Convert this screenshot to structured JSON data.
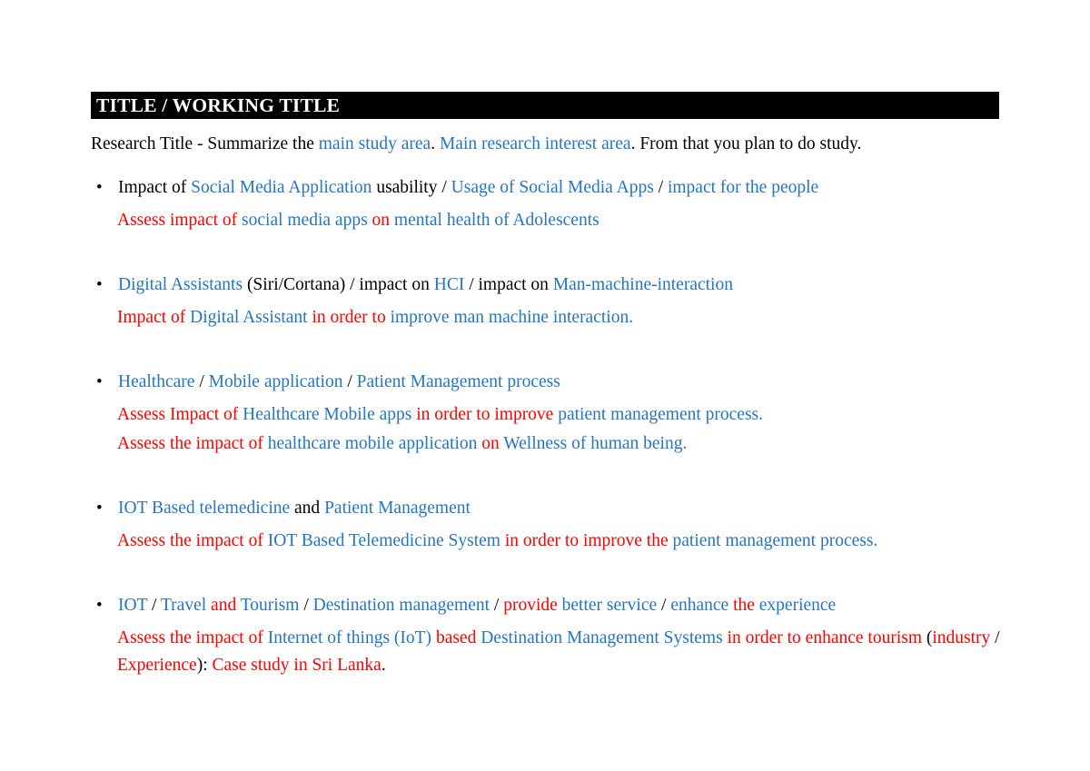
{
  "document": {
    "heading": "TITLE / WORKING TITLE",
    "intro": {
      "part1": "Research Title - Summarize the ",
      "part2": "main study area",
      "part3": ". ",
      "part4": "Main research interest area",
      "part5": ". From that you plan to do study."
    },
    "bullet_marker": "•",
    "items": [
      {
        "topic": {
          "s1": "Impact of ",
          "s2": "Social Media Application",
          "s3": " usability ",
          "s4": "/",
          "s5": " Usage of Social Media Apps ",
          "s6": "/",
          "s7": " impact for the people"
        },
        "subs": [
          {
            "s1": "Assess impact of ",
            "s2": "social media apps ",
            "s3": "on ",
            "s4": "mental health of Adolescents"
          }
        ]
      },
      {
        "topic": {
          "s1": "Digital Assistants",
          "s2": " (Siri/Cortana) / impact on ",
          "s3": "HCI",
          "s4": " / impact on ",
          "s5": "Man-machine-interaction"
        },
        "subs": [
          {
            "s1": "Impact of ",
            "s2": "Digital Assistant ",
            "s3": "in order to ",
            "s4": "improve man machine interaction."
          }
        ]
      },
      {
        "topic": {
          "s1": "Healthcare ",
          "s2": "/",
          "s3": " Mobile application ",
          "s4": "/",
          "s5": " Patient Management process"
        },
        "subs": [
          {
            "s1": "Assess Impact of ",
            "s2": "Healthcare Mobile apps ",
            "s3": "in order to improve ",
            "s4": "patient management process."
          },
          {
            "s1": "Assess the impact of ",
            "s2": "healthcare mobile application ",
            "s3": "on ",
            "s4": "Wellness of human being."
          }
        ]
      },
      {
        "topic": {
          "s1": "IOT Based telemedicine",
          "s2": " and ",
          "s3": "Patient Management"
        },
        "subs": [
          {
            "s1": "Assess the impact of ",
            "s2": "IOT Based Telemedicine System ",
            "s3": "in order to improve the ",
            "s4": "patient management process."
          }
        ]
      },
      {
        "topic": {
          "s1": "IOT ",
          "s2": "/",
          "s3": " Travel ",
          "s4": "and ",
          "s5": "Tourism ",
          "s6": "/",
          "s7": " Destination management ",
          "s8": "/",
          "s9": " provide ",
          "s10": "better service ",
          "s11": "/",
          "s12": " enhance ",
          "s13": "the ",
          "s14": "experience"
        },
        "subs": [
          {
            "s1": "Assess the impact of ",
            "s2": "Internet of things (IoT) ",
            "s3": "based ",
            "s4": "Destination Management Systems ",
            "s5": "in order to enhance tourism ",
            "s6": "(",
            "s7": "industry ",
            "s8": "/ ",
            "s9": "Experience",
            "s10": ")",
            "s11": ": ",
            "s12": "Case study in Sri Lanka",
            "s13": "."
          }
        ]
      }
    ]
  },
  "colors": {
    "blue": "#2775C0",
    "red": "#FF0000",
    "black": "#000000",
    "heading_background": "#000000",
    "heading_text": "#FFFFFF",
    "page_background": "#FFFFFF"
  }
}
